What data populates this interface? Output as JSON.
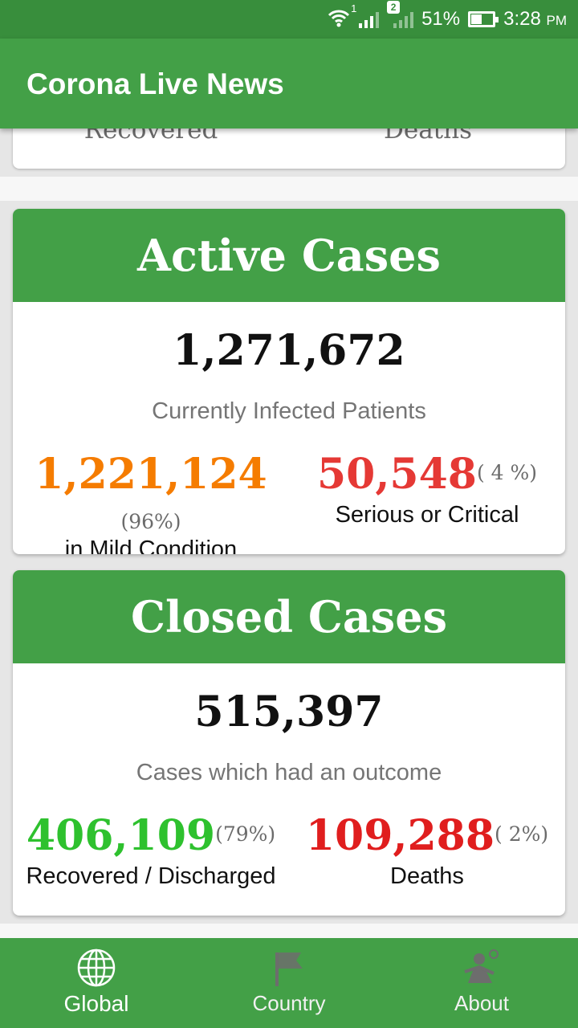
{
  "status_bar": {
    "wifi_icon": "wifi-icon",
    "sim1_label": "1",
    "sim2_label": "2",
    "battery_percent": "51%",
    "battery_level": 0.51,
    "time": "3:28",
    "ampm": "PM"
  },
  "app_bar": {
    "title": "Corona Live News"
  },
  "previous_card": {
    "left_label": "Recovered",
    "right_label": "Deaths"
  },
  "active_cases": {
    "title": "Active Cases",
    "total": "1,271,672",
    "subtitle": "Currently Infected Patients",
    "left": {
      "value": "1,221,124",
      "percent": "(96%)",
      "label": "in Mild Condition",
      "color": "#f57c00"
    },
    "right": {
      "value": "50,548",
      "percent": "( 4 %)",
      "label": "Serious or Critical",
      "color": "#e53935"
    }
  },
  "closed_cases": {
    "title": "Closed Cases",
    "total": "515,397",
    "subtitle": "Cases which had an outcome",
    "left": {
      "value": "406,109",
      "percent": "(79%)",
      "label": "Recovered / Discharged",
      "color": "#2ec12e"
    },
    "right": {
      "value": "109,288",
      "percent": "( 2%)",
      "label": "Deaths",
      "color": "#e01e1e"
    }
  },
  "bottom_nav": {
    "items": [
      {
        "label": "Global",
        "icon": "globe-icon",
        "active": true
      },
      {
        "label": "Country",
        "icon": "flag-icon",
        "active": false
      },
      {
        "label": "About",
        "icon": "person-icon",
        "active": false
      }
    ]
  },
  "colors": {
    "primary": "#43a047",
    "primary_dark": "#388e3c"
  }
}
